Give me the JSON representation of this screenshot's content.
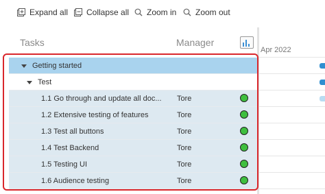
{
  "toolbar": {
    "expand_all": "Expand all",
    "collapse_all": "Collapse all",
    "zoom_in": "Zoom in",
    "zoom_out": "Zoom out"
  },
  "grid": {
    "col_tasks": "Tasks",
    "col_manager": "Manager",
    "rows": [
      {
        "label": "Getting started",
        "manager": "",
        "status": ""
      },
      {
        "label": "Test",
        "manager": "",
        "status": ""
      },
      {
        "label": "1.1 Go through and update all doc...",
        "manager": "Tore",
        "status": "green"
      },
      {
        "label": "1.2 Extensive testing of features",
        "manager": "Tore",
        "status": "green"
      },
      {
        "label": "1.3 Test all buttons",
        "manager": "Tore",
        "status": "green"
      },
      {
        "label": "1.4 Test Backend",
        "manager": "Tore",
        "status": "green"
      },
      {
        "label": "1.5 Testing UI",
        "manager": "Tore",
        "status": "green"
      },
      {
        "label": "1.6 Audience testing",
        "manager": "Tore",
        "status": "green"
      }
    ]
  },
  "gantt": {
    "date_label": "Apr 2022"
  },
  "colors": {
    "selected_row": "#a9d3ee",
    "task_row": "#dde9f1",
    "status_green": "#3fbf3f",
    "highlight": "#d9262b",
    "bar_blue": "#2f8fd0",
    "bar_light": "#b9dcf2"
  }
}
